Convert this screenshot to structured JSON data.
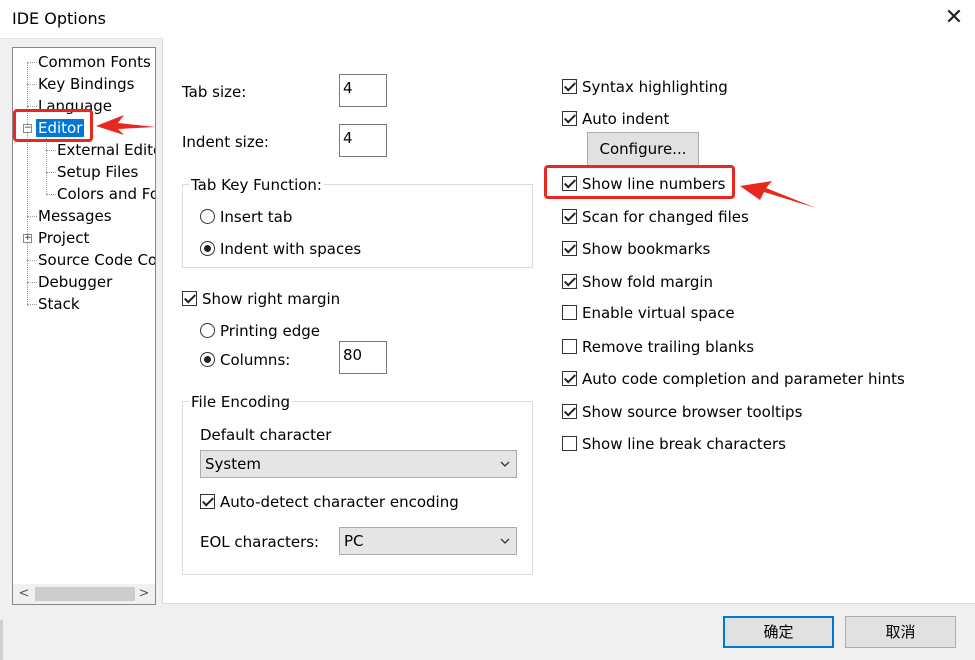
{
  "window": {
    "title": "IDE Options",
    "close_glyph": "✕"
  },
  "tree": {
    "items": [
      {
        "label": "Common Fonts"
      },
      {
        "label": "Key Bindings"
      },
      {
        "label": "Language"
      },
      {
        "label": "Editor"
      },
      {
        "label": "External Edito"
      },
      {
        "label": "Setup Files"
      },
      {
        "label": "Colors and Fo"
      },
      {
        "label": "Messages"
      },
      {
        "label": "Project"
      },
      {
        "label": "Source Code Co"
      },
      {
        "label": "Debugger"
      },
      {
        "label": "Stack"
      }
    ],
    "collapse_glyph": "−",
    "expand_glyph": "+",
    "scroll_left": "<",
    "scroll_right": ">"
  },
  "left": {
    "tab_size_label": "Tab size:",
    "tab_size_value": "4",
    "indent_size_label": "Indent size:",
    "indent_size_value": "4",
    "tab_key_group": "Tab Key Function:",
    "insert_tab": "Insert tab",
    "indent_with_spaces": "Indent with spaces",
    "show_right_margin": "Show right margin",
    "printing_edge": "Printing edge",
    "columns_label": "Columns:",
    "columns_value": "80",
    "file_encoding_group": "File Encoding",
    "default_character_label": "Default character",
    "default_character_value": "System",
    "auto_detect": "Auto-detect character encoding",
    "eol_label": "EOL characters:",
    "eol_value": "PC"
  },
  "right": {
    "syntax_highlighting": "Syntax highlighting",
    "auto_indent": "Auto indent",
    "configure_button": "Configure...",
    "show_line_numbers": "Show line numbers",
    "scan_changed_files": "Scan for changed files",
    "show_bookmarks": "Show bookmarks",
    "show_fold_margin": "Show fold margin",
    "enable_virtual_space": "Enable virtual space",
    "remove_trailing_blanks": "Remove trailing blanks",
    "auto_code_completion": "Auto code completion and parameter hints",
    "show_source_browser_tooltips": "Show source browser tooltips",
    "show_line_break_characters": "Show line break characters"
  },
  "buttons": {
    "ok": "确定",
    "cancel": "取消"
  },
  "colors": {
    "selection": "#0078d7",
    "annotation": "#e8281e"
  }
}
